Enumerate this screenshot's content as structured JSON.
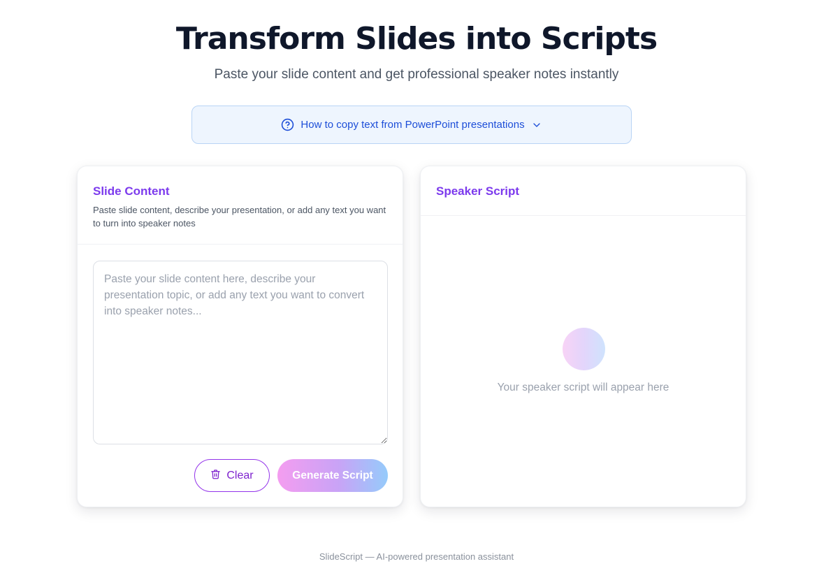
{
  "hero": {
    "title": "Transform Slides into Scripts",
    "subtitle": "Paste your slide content and get professional speaker notes instantly"
  },
  "help": {
    "label": "How to copy text from PowerPoint presentations",
    "icon": "question-circle-icon",
    "expand_icon": "chevron-down-icon",
    "color": "#1d4ed8"
  },
  "input_card": {
    "title": "Slide Content",
    "description": "Paste slide content, describe your presentation, or add any text you want to turn into speaker notes",
    "textarea": {
      "value": "",
      "placeholder": "Paste your slide content here, describe your presentation topic, or add any text you want to convert into speaker notes..."
    },
    "clear_label": "Clear",
    "clear_icon": "trash-icon",
    "generate_label": "Generate Script"
  },
  "output_card": {
    "title": "Speaker Script",
    "empty_message": "Your speaker script will appear here"
  },
  "footer": {
    "text": "SlideScript — AI-powered presentation assistant"
  },
  "colors": {
    "accent": "#7c3aed",
    "help_bg": "#eef5fe",
    "gradient_start": "#f49df0",
    "gradient_end": "#95cbfb"
  }
}
